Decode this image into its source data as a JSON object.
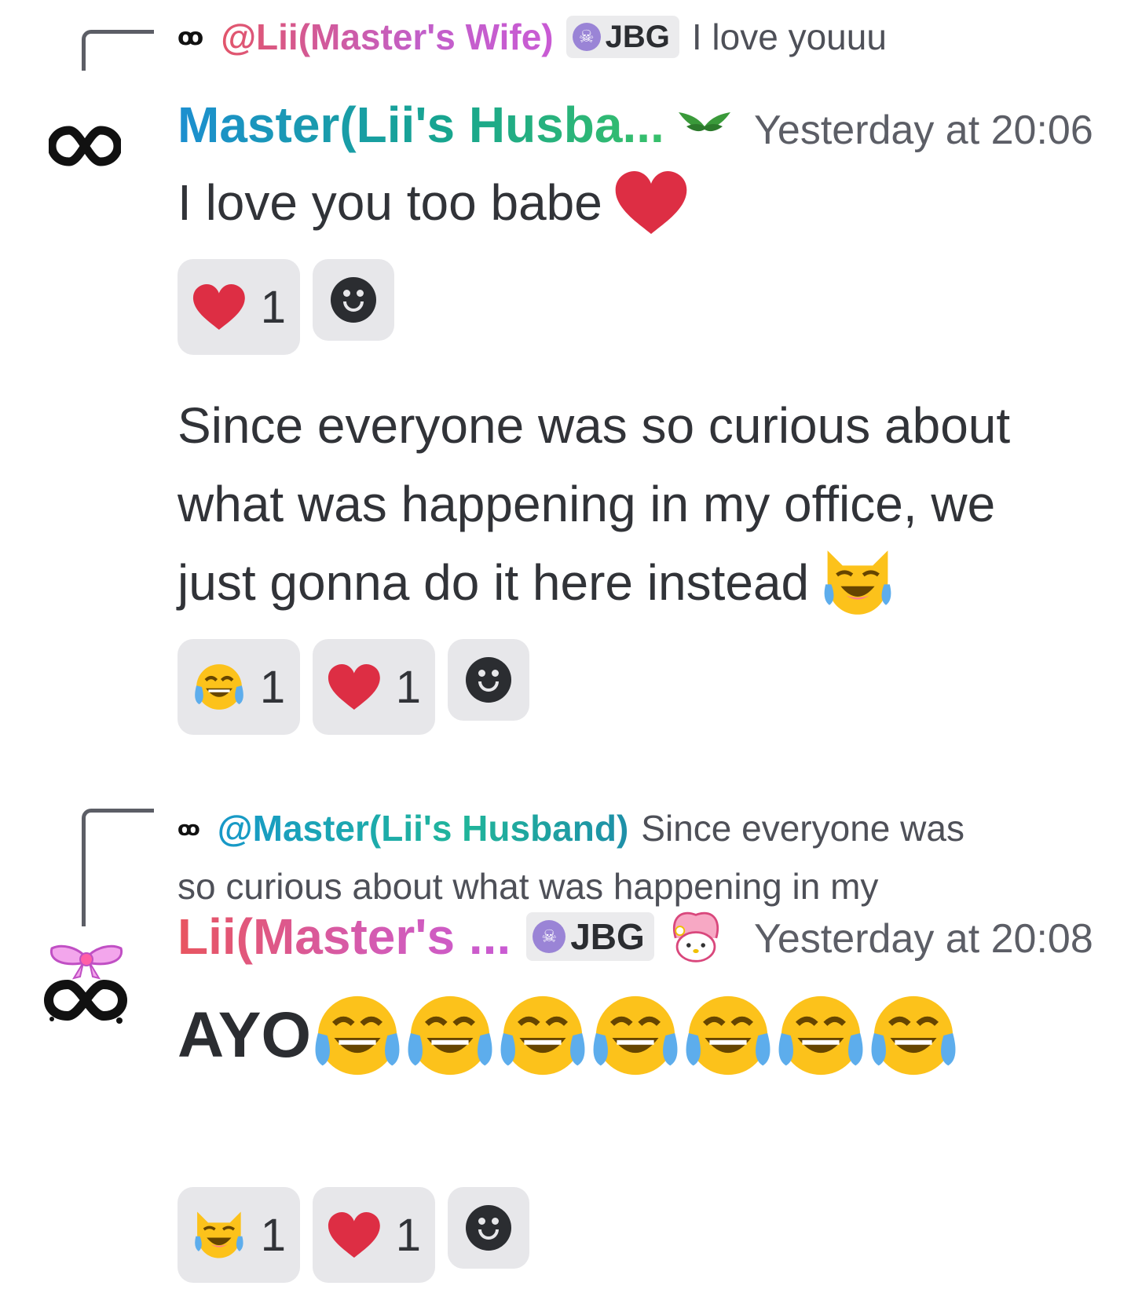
{
  "messages": [
    {
      "reply": {
        "mention": "@Lii(Master's Wife)",
        "tag": "JBG",
        "preview": "I love youuu"
      },
      "username": "Master(Lii's Husba...",
      "timestamp": "Yesterday at 20:06",
      "text": "I love you too babe",
      "reactions": [
        {
          "emoji": "heart",
          "count": "1"
        }
      ]
    },
    {
      "text_lines": [
        "Since everyone was so curious about",
        "what was happening in my office, we",
        "just gonna do it here instead"
      ],
      "reactions": [
        {
          "emoji": "joy",
          "count": "1"
        },
        {
          "emoji": "heart",
          "count": "1"
        }
      ]
    },
    {
      "reply": {
        "mention": "@Master(Lii's Husband)",
        "preview_line1": "Since everyone was",
        "preview_line2": "so curious about what was happening in my"
      },
      "username": "Lii(Master's ...",
      "tag": "JBG",
      "timestamp": "Yesterday at 20:08",
      "text": "AYO",
      "reactions": [
        {
          "emoji": "joy-cat",
          "count": "1"
        },
        {
          "emoji": "heart",
          "count": "1"
        }
      ]
    }
  ],
  "colors": {
    "heart": "#dd2e44",
    "emoji_yellow": "#fcc21b",
    "tear_blue": "#5dadec"
  }
}
